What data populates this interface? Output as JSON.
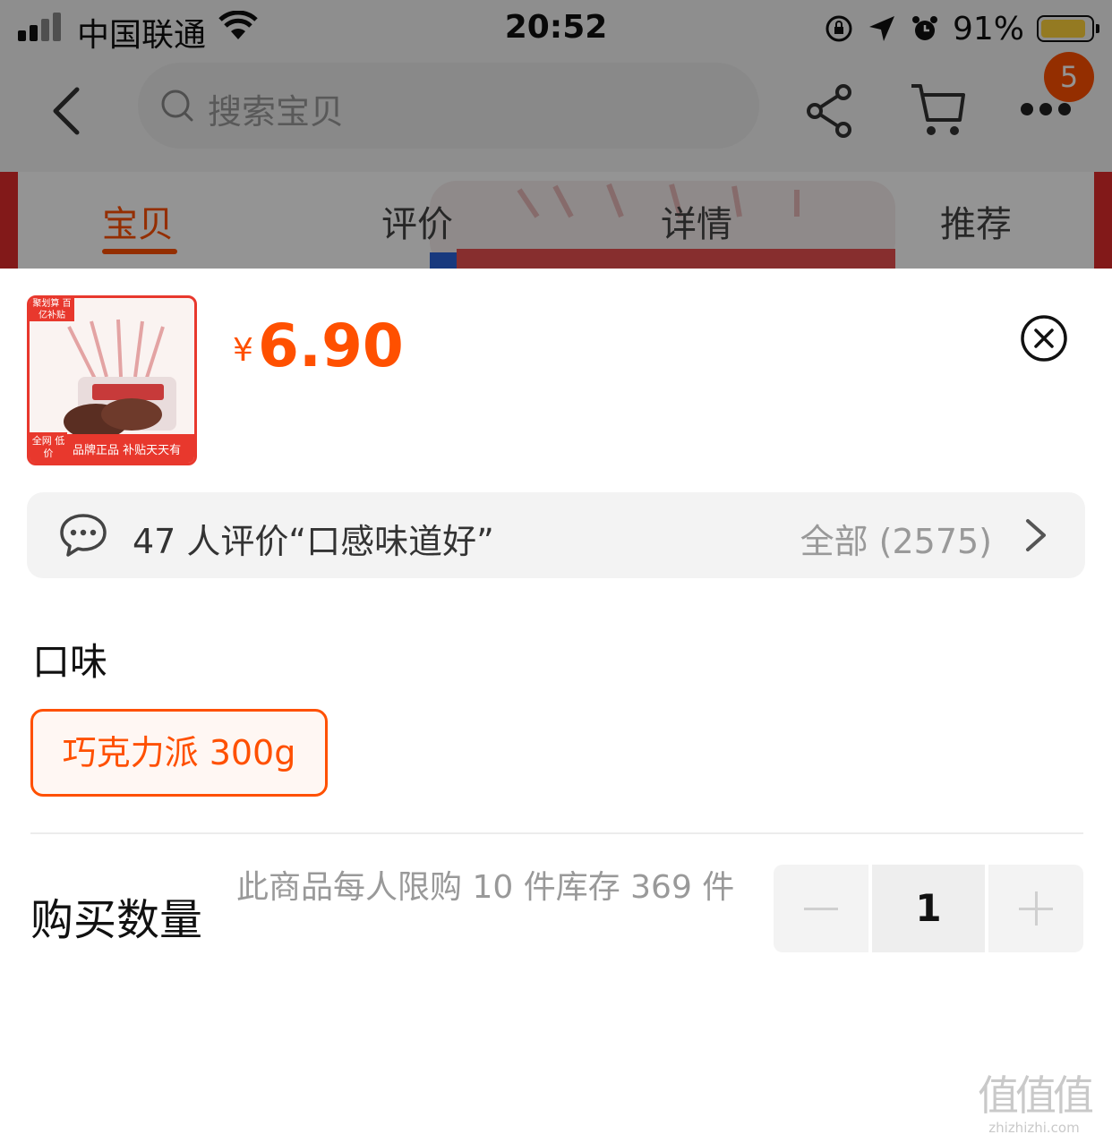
{
  "status_bar": {
    "carrier": "中国联通",
    "time": "20:52",
    "battery_percent": "91%",
    "battery_level": 0.91
  },
  "nav": {
    "search_placeholder": "搜索宝贝",
    "badge_count": "5"
  },
  "tabs": [
    {
      "label": "宝贝",
      "active": true
    },
    {
      "label": "评价",
      "active": false
    },
    {
      "label": "详情",
      "active": false
    },
    {
      "label": "推荐",
      "active": false
    }
  ],
  "product": {
    "currency": "¥",
    "price": "6.90",
    "thumb_tag_top": "聚划算 百亿补贴",
    "thumb_badge": "全网 低价",
    "thumb_banner": "品牌正品 补贴天天有"
  },
  "review": {
    "summary": "47 人评价“口感味道好”",
    "all_label": "全部 (2575)"
  },
  "flavor": {
    "title": "口味",
    "selected_option": "巧克力派 300g"
  },
  "quantity": {
    "label": "购买数量",
    "note": "此商品每人限购 10 件库存 369 件",
    "value": "1"
  },
  "watermark": {
    "logo": "值值值",
    "url": "zhizhizhi.com"
  },
  "colors": {
    "accent": "#ff5000",
    "badge": "#ff5000",
    "thumb_border": "#e8382d"
  }
}
